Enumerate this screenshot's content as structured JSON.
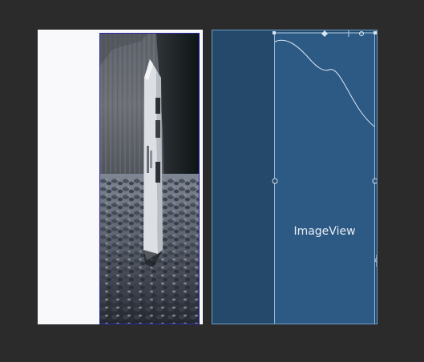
{
  "blueprint": {
    "view_label": "ImageView"
  },
  "design": {
    "image_description_icon": "milk-carton-on-pebbles-photo"
  },
  "colors": {
    "background": "#2b2b2b",
    "design_surface": "#f9f9fb",
    "blueprint_surface": "#25496b",
    "blueprint_view": "#2d5a85",
    "blueprint_line": "#8fb8dc",
    "selection_border": "#2a2aa8"
  }
}
